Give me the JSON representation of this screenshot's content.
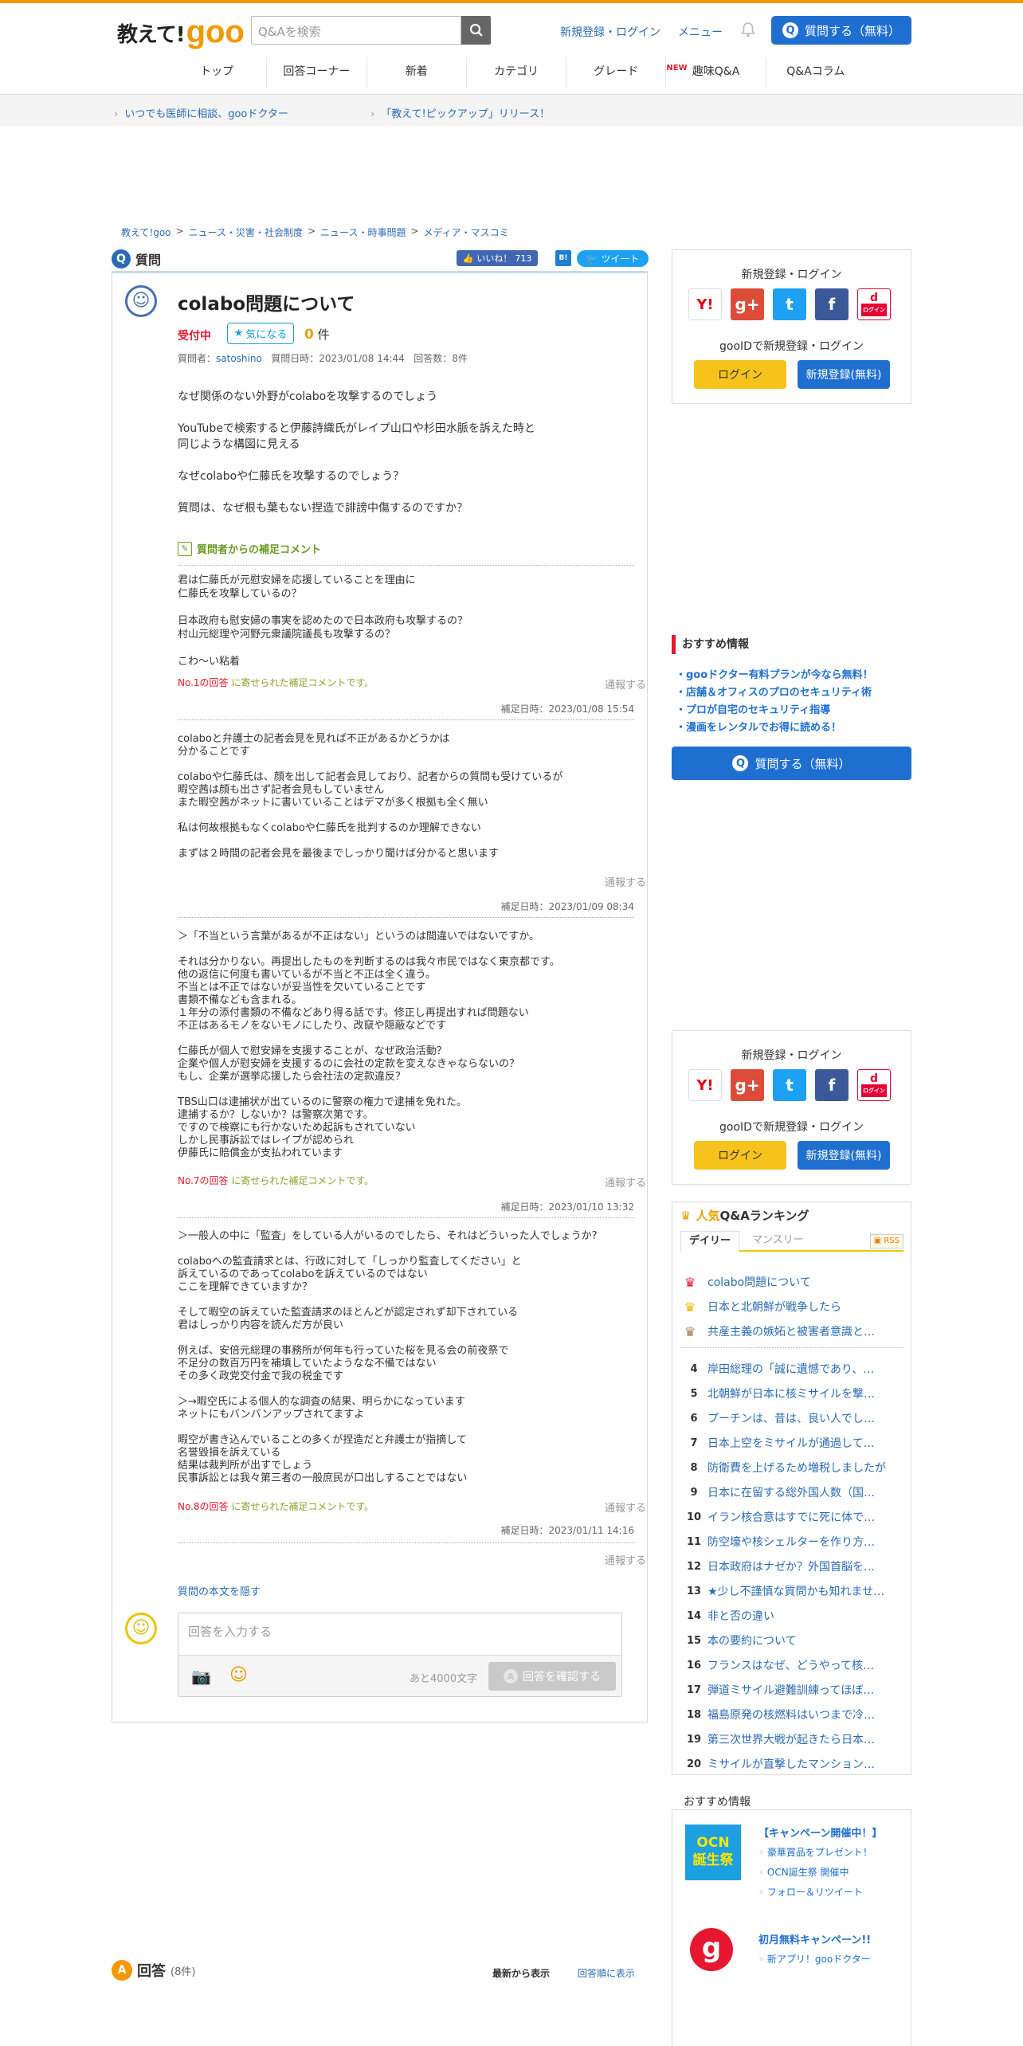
{
  "header": {
    "logo_jp": "教えて!",
    "logo_goo": "goo",
    "search_placeholder": "Q&Aを検索",
    "signup_login": "新規登録・ログイン",
    "menu": "メニュー",
    "ask_button": "質問する（無料）",
    "nav": [
      {
        "label": "トップ",
        "new": ""
      },
      {
        "label": "回答コーナー",
        "new": ""
      },
      {
        "label": "新着",
        "new": ""
      },
      {
        "label": "カテゴリ",
        "new": ""
      },
      {
        "label": "グレード",
        "new": ""
      },
      {
        "label": "趣味Q&A",
        "new": "NEW"
      },
      {
        "label": "Q&Aコラム",
        "new": ""
      }
    ]
  },
  "subbar": {
    "link1": "いつでも医師に相談、gooドクター",
    "link2": "「教えて!ピックアップ」リリース！"
  },
  "breadcrumb": [
    "教えて!goo",
    "ニュース・災害・社会制度",
    "ニュース・時事問題",
    "メディア・マスコミ"
  ],
  "question": {
    "heading": "質問",
    "like_label": "いいね！",
    "like_count": "713",
    "hatena": "B!",
    "tweet": "ツイート",
    "title": "colabo問題について",
    "status": "受付中",
    "fav_label": "気になる",
    "fav_count": "0",
    "fav_unit": "件",
    "meta_asker_label": "質問者：",
    "asker": "satoshino",
    "meta_date": "質問日時：2023/01/08 14:44",
    "meta_answers": "回答数：8件",
    "body": "なぜ関係のない外野がcolaboを攻撃するのでしょう\n\nYouTubeで検索すると伊藤詩織氏がレイプ山口や杉田水脈を訴えた時と\n同じような構図に見える\n\nなぜcolaboや仁藤氏を攻撃するのでしょう？\n\n質問は、なぜ根も葉もない捏造で誹謗中傷するのですか？",
    "supp_heading": "質問者からの補足コメント",
    "supps": [
      {
        "text": "君は仁藤氏が元慰安婦を応援していることを理由に\n仁藤氏を攻撃しているの？\n\n日本政府も慰安婦の事実を認めたので日本政府も攻撃するの？\n村山元総理や河野元衆議院議長も攻撃するの？\n\nこわ〜い粘着",
        "from_no": "No.1の回答",
        "from_rest": " に寄せられた補足コメントです。",
        "report": "通報する",
        "date": "補足日時：2023/01/08 15:54"
      },
      {
        "text": "colaboと弁護士の記者会見を見れば不正があるかどうかは\n分かることです\n\ncolaboや仁藤氏は、顔を出して記者会見しており、記者からの質問も受けているが\n暇空茜は顔も出さず記者会見もしていません\nまた暇空茜がネットに書いていることはデマが多く根拠も全く無い\n\n私は何故根拠もなくcolaboや仁藤氏を批判するのか理解できない\n\nまずは２時間の記者会見を最後までしっかり聞けば分かると思います",
        "from_no": "",
        "from_rest": "",
        "report": "通報する",
        "date": "補足日時：2023/01/09 08:34"
      },
      {
        "text": "＞「不当という言葉があるが不正はない」というのは間違いではないですか。\n\nそれは分かりない。再提出したものを判断するのは我々市民ではなく東京都です。\n他の返信に何度も書いているが不当と不正は全く違う。\n不当とは不正ではないが妥当性を欠いていることです\n書類不備なども含まれる。\n１年分の添付書類の不備などあり得る話です。修正し再提出すれば問題ない\n不正はあるモノをないモノにしたり、改竄や隠蔽などです\n\n仁藤氏が個人で慰安婦を支援することが、なぜ政治活動？\n企業や個人が慰安婦を支援するのに会社の定款を変えなきゃならないの？\nもし、企業が選挙応援したら会社法の定款違反？\n\nTBS山口は逮捕状が出ているのに警察の権力で逮捕を免れた。\n逮捕するか？しないか？は警察次第です。\nですので検察にも行かないため起訴もされていない\nしかし民事訴訟ではレイプが認められ\n伊藤氏に賠償金が支払われています",
        "from_no": "No.7の回答",
        "from_rest": " に寄せられた補足コメントです。",
        "report": "通報する",
        "date": "補足日時：2023/01/10 13:32"
      },
      {
        "text": "＞一般人の中に「監査」をしている人がいるのでしたら、それはどういった人でしょうか?\n\ncolaboへの監査請求とは、行政に対して「しっかり監査してください」と\n訴えているのであってcolaboを訴えているのではない\nここを理解できていますか？\n\nそして暇空の訴えていた監査請求のほとんどが認定されず却下されている\n君はしっかり内容を読んだ方が良い\n\n例えば、安倍元総理の事務所が何年も行っていた桜を見る会の前夜祭で\n不足分の数百万円を補填していたようなな不備ではない\nその多く政党交付金で我の税金です\n\n＞→暇空氏による個人的な調査の結果、明らかになっています\nネットにもバンバンアップされてますよ\n\n暇空が書き込んでいることの多くが捏造だと弁護士が指摘して\n名誉毀損を訴えている\n結果は裁判所が出すでしょう\n民事訴訟とは我々第三者の一般庶民が口出しすることではない",
        "from_no": "No.8の回答",
        "from_rest": " に寄せられた補足コメントです。",
        "report": "通報する",
        "date": "補足日時：2023/01/11 14:16"
      }
    ],
    "last_report": "通報する",
    "hide_link": "質問の本文を隠す"
  },
  "answer_form": {
    "placeholder": "回答を入力する",
    "remain": "あと4000文字",
    "confirm": "回答を確認する"
  },
  "answers": {
    "heading": "回答",
    "count": "(8件)",
    "sort_new": "最新から表示",
    "sort_old": "回答順に表示"
  },
  "sidebar": {
    "login_title": "新規登録・ログイン",
    "gooid": "gooIDで新規登録・ログイン",
    "login": "ログイン",
    "signup": "新規登録(無料)",
    "sns": [
      "Y!",
      "g+",
      "t",
      "f",
      "d"
    ],
    "sns_sub": "ログイン",
    "osusume_title": "おすすめ情報",
    "osusume": [
      "・gooドクター有料プランが今なら無料！",
      "・店舗＆オフィスのプロのセキュリティ術",
      "・プロが自宅のセキュリティ指導",
      "・漫画をレンタルでお得に読める！"
    ],
    "ask": "質問する（無料）",
    "ranking": {
      "title_hi": "人気",
      "title": "Q&Aランキング",
      "daily": "デイリー",
      "monthly": "マンスリー",
      "rss": "RSS",
      "items": [
        {
          "rank": "1",
          "text": "colabo問題について"
        },
        {
          "rank": "2",
          "text": "日本と北朝鮮が戦争したら"
        },
        {
          "rank": "3",
          "text": "共産主義の嫉妬と被害者意識と…"
        },
        {
          "rank": "4",
          "text": "岸田総理の「誠に遺憾であり、…"
        },
        {
          "rank": "5",
          "text": "北朝鮮が日本に核ミサイルを撃…"
        },
        {
          "rank": "6",
          "text": "プーチンは、昔は、良い人でし…"
        },
        {
          "rank": "7",
          "text": "日本上空をミサイルが通過して…"
        },
        {
          "rank": "8",
          "text": "防衛費を上げるため増税しましたが"
        },
        {
          "rank": "9",
          "text": "日本に在留する総外国人数（国…"
        },
        {
          "rank": "10",
          "text": "イラン核合意はすでに死に体で…"
        },
        {
          "rank": "11",
          "text": "防空壕や核シェルターを作り方…"
        },
        {
          "rank": "12",
          "text": "日本政府はナゼか？外国首脳を…"
        },
        {
          "rank": "13",
          "text": "★少し不謹慎な質問かも知れませ…"
        },
        {
          "rank": "14",
          "text": "非と否の違い"
        },
        {
          "rank": "15",
          "text": "本の要約について"
        },
        {
          "rank": "16",
          "text": "フランスはなぜ、どうやって核…"
        },
        {
          "rank": "17",
          "text": "弾道ミサイル避難訓練ってほぼ…"
        },
        {
          "rank": "18",
          "text": "福島原発の核燃料はいつまで冷…"
        },
        {
          "rank": "19",
          "text": "第三次世界大戦が起きたら日本…"
        },
        {
          "rank": "20",
          "text": "ミサイルが直撃したマンション…"
        }
      ]
    },
    "rec_title": "おすすめ情報",
    "rec": {
      "ocn_logo": "OCN\n誕生祭",
      "ocn_head": "【キャンペーン開催中！】",
      "ocn_items": [
        "豪華賞品をプレゼント！",
        "OCN誕生祭 開催中",
        "フォロー＆リツイート"
      ],
      "goo_logo": "g",
      "goo_head": "初月無料キャンペーン!!",
      "goo_items": [
        "新アプリ！gooドクター"
      ]
    }
  }
}
